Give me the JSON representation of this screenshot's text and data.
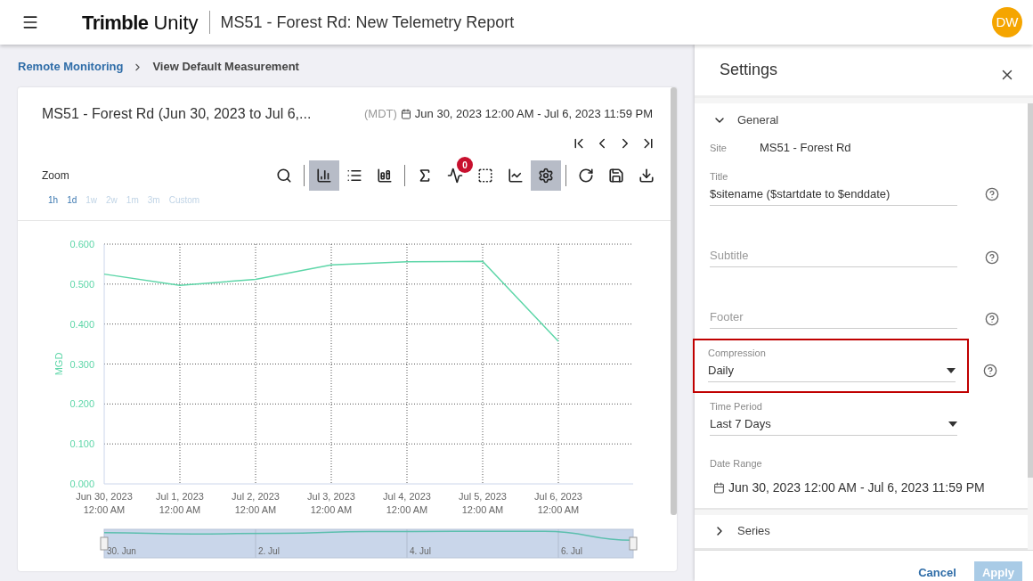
{
  "header": {
    "logo": {
      "brand": "Trimble",
      "product": "Unity"
    },
    "title": "MS51 - Forest Rd: New Telemetry Report",
    "avatar": "DW"
  },
  "breadcrumb": [
    {
      "label": "Remote Monitoring",
      "kind": "link"
    },
    {
      "label": "View Default Measurement",
      "kind": "current"
    }
  ],
  "report": {
    "title": "MS51 - Forest Rd (Jun 30, 2023 to Jul 6,...",
    "timezone": "(MDT)",
    "date_range": "Jun 30, 2023 12:00 AM - Jul 6, 2023 11:59 PM",
    "pager": [
      {
        "kind": "first"
      },
      {
        "kind": "previous"
      },
      {
        "kind": "next"
      },
      {
        "kind": "last"
      }
    ],
    "zoom": {
      "label": "Zoom",
      "options": [
        {
          "label": "1h",
          "disabled": false
        },
        {
          "label": "1d",
          "disabled": false
        },
        {
          "label": "1w",
          "disabled": true
        },
        {
          "label": "2w",
          "disabled": true
        },
        {
          "label": "1m",
          "disabled": true
        },
        {
          "label": "3m",
          "disabled": true
        },
        {
          "label": "Custom",
          "disabled": true
        }
      ]
    },
    "toolbar": [
      {
        "buttons": [
          {
            "kind": "search",
            "selected": false
          }
        ]
      },
      {
        "buttons": [
          {
            "kind": "bar-chart",
            "selected": true
          },
          {
            "kind": "list",
            "selected": false
          },
          {
            "kind": "stacked-chart",
            "selected": false
          }
        ]
      },
      {
        "buttons": [
          {
            "kind": "sum",
            "selected": false
          },
          {
            "kind": "pulse",
            "selected": false,
            "badge": "0"
          },
          {
            "kind": "select-area",
            "selected": false
          },
          {
            "kind": "line-chart",
            "selected": false
          },
          {
            "kind": "settings",
            "selected": true
          }
        ]
      },
      {
        "buttons": [
          {
            "kind": "refresh",
            "selected": false
          },
          {
            "kind": "save",
            "selected": false
          },
          {
            "kind": "download",
            "selected": false
          }
        ]
      }
    ],
    "chart_data": {
      "type": "line",
      "ylabel": "MGD",
      "categories": [
        "Jun 30, 2023\n12:00 AM",
        "Jul 1, 2023\n12:00 AM",
        "Jul 2, 2023\n12:00 AM",
        "Jul 3, 2023\n12:00 AM",
        "Jul 4, 2023\n12:00 AM",
        "Jul 5, 2023\n12:00 AM",
        "Jul 6, 2023\n12:00 AM"
      ],
      "grid": true,
      "series": [
        {
          "color": "#5dd6a8",
          "values": [
            0.525,
            0.497,
            0.512,
            0.548,
            0.556,
            0.557,
            0.357
          ]
        }
      ],
      "ylim": [
        0,
        0.6
      ],
      "yticks": [
        {
          "value": 0,
          "label": "0.000"
        },
        {
          "value": 0.1,
          "label": "0.100"
        },
        {
          "value": 0.2,
          "label": "0.200"
        },
        {
          "value": 0.3,
          "label": "0.300"
        },
        {
          "value": 0.4,
          "label": "0.400"
        },
        {
          "value": 0.5,
          "label": "0.500"
        },
        {
          "value": 0.6,
          "label": "0.600"
        }
      ]
    },
    "navigator": {
      "labels": [
        "30. Jun",
        "2. Jul",
        "4. Jul",
        "6. Jul"
      ]
    }
  },
  "settings": {
    "title": "Settings",
    "sections": [
      {
        "label": "General",
        "expanded": true,
        "fields": [
          {
            "kind": "static",
            "label": "Site",
            "value": "MS51 - Forest Rd"
          },
          {
            "kind": "text",
            "label": "Title",
            "value": "$sitename ($startdate to $enddate)",
            "help": true,
            "highlighted": false
          },
          {
            "kind": "text",
            "placeholder": "Subtitle",
            "help": true,
            "highlighted": false
          },
          {
            "kind": "text",
            "placeholder": "Footer",
            "help": true,
            "highlighted": false
          },
          {
            "kind": "select",
            "label": "Compression",
            "value": "Daily",
            "help": true,
            "highlighted": true
          },
          {
            "kind": "select",
            "label": "Time Period",
            "value": "Last 7 Days",
            "help": false,
            "highlighted": false
          },
          {
            "kind": "date",
            "label": "Date Range",
            "value": "Jun 30, 2023 12:00 AM - Jul 6, 2023 11:59 PM"
          }
        ]
      },
      {
        "label": "Series",
        "expanded": false
      }
    ],
    "buttons": [
      {
        "label": "Cancel",
        "kind": "link",
        "disabled": false
      },
      {
        "label": "Apply",
        "kind": "primary",
        "disabled": true
      }
    ]
  }
}
